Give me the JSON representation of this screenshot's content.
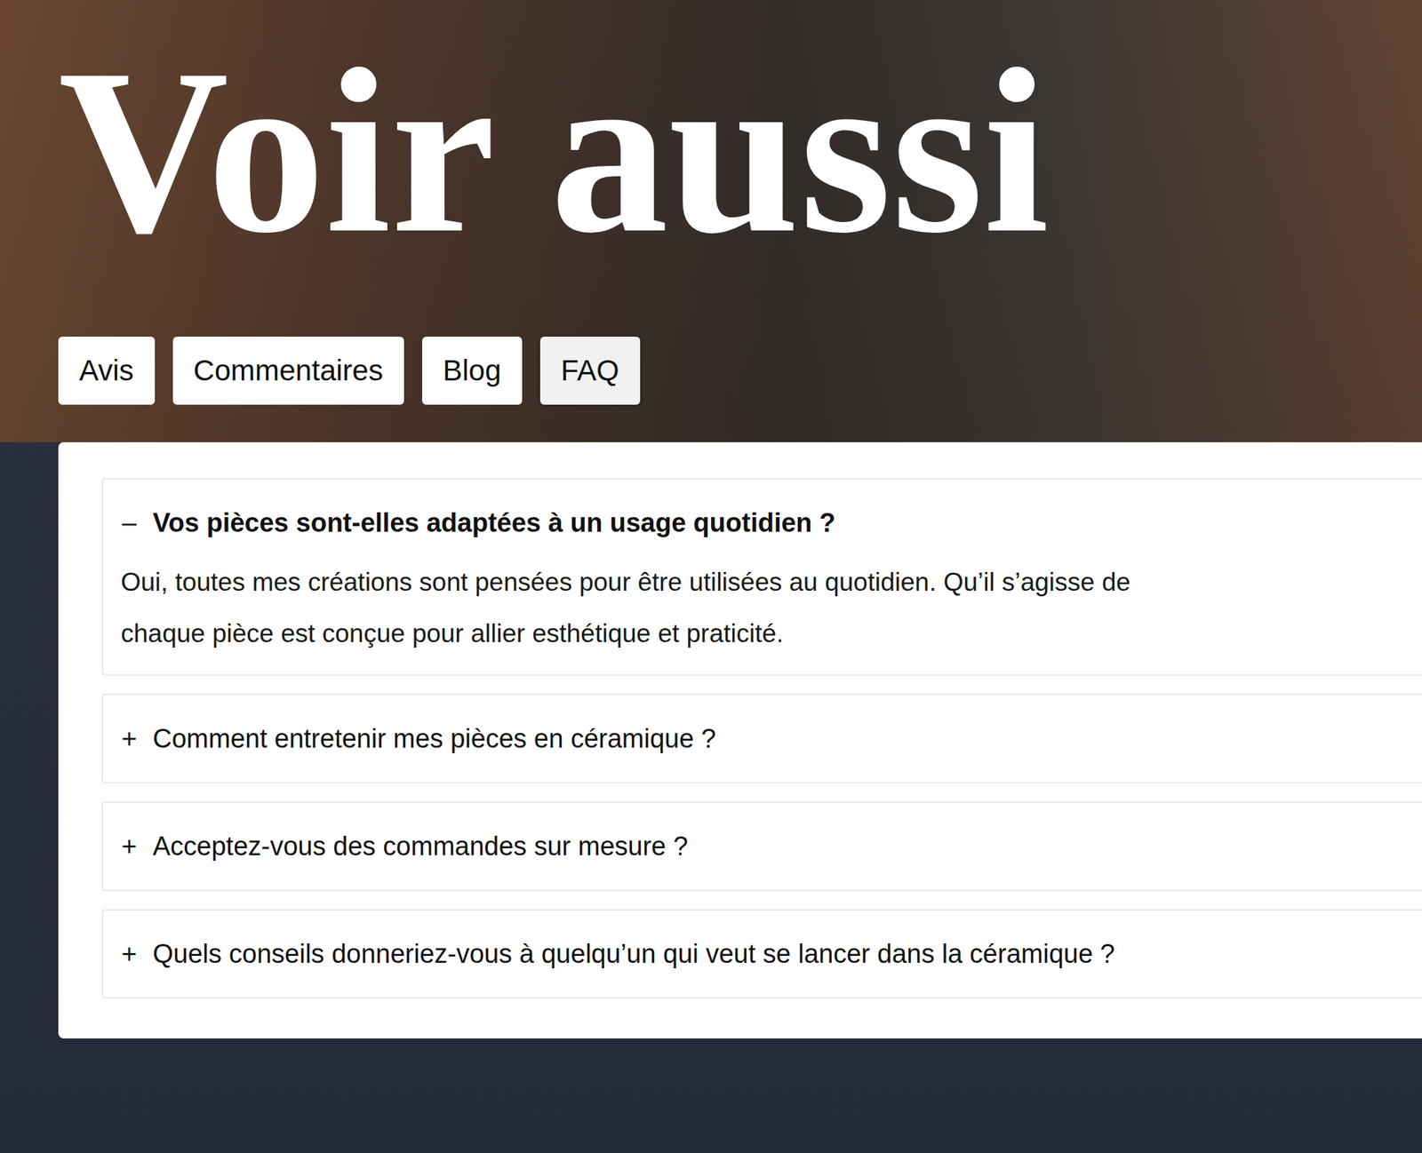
{
  "heading": "Voir aussi",
  "tabs": [
    {
      "label": "Avis",
      "selected": false
    },
    {
      "label": "Commentaires",
      "selected": false
    },
    {
      "label": "Blog",
      "selected": false
    },
    {
      "label": "FAQ",
      "selected": true
    }
  ],
  "faq": [
    {
      "toggle": "–",
      "question": "Vos pièces sont-elles adaptées à un usage quotidien ?",
      "expanded": true,
      "answer_lines": [
        "Oui, toutes mes créations sont pensées pour être utilisées au quotidien. Qu’il s’agisse de",
        "chaque pièce est conçue pour allier esthétique et praticité."
      ]
    },
    {
      "toggle": "+",
      "question": "Comment entretenir mes pièces en céramique ?",
      "expanded": false,
      "answer_lines": []
    },
    {
      "toggle": "+",
      "question": "Acceptez-vous des commandes sur mesure ?",
      "expanded": false,
      "answer_lines": []
    },
    {
      "toggle": "+",
      "question": "Quels conseils donneriez-vous à quelqu’un qui veut se lancer dans la céramique ?",
      "expanded": false,
      "answer_lines": []
    }
  ]
}
